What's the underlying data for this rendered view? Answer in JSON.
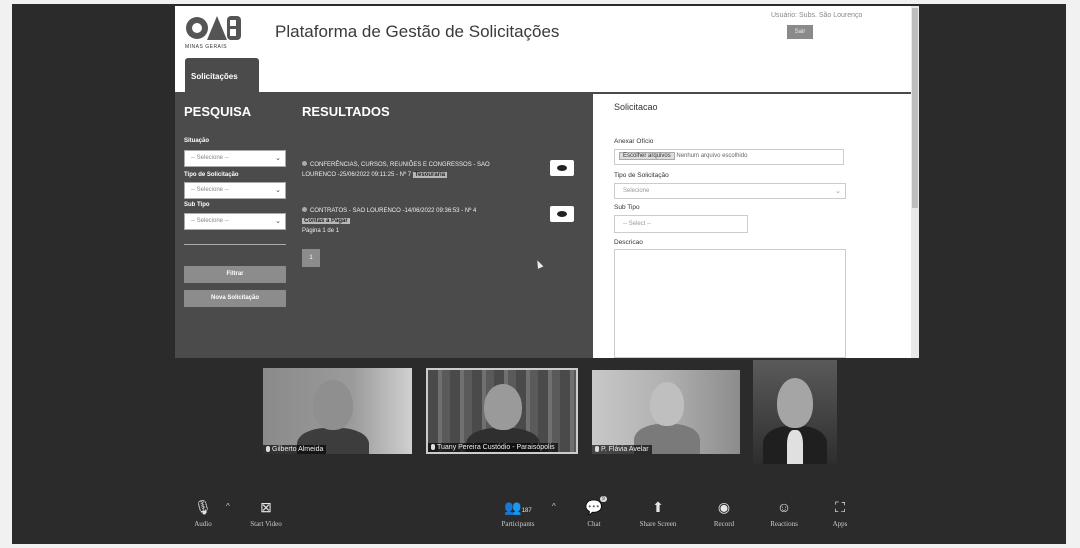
{
  "app": {
    "title": "Plataforma de Gestão de Solicitações",
    "logo_text": "OAB",
    "logo_sub": "MINAS GERAIS",
    "user_name": "Usuário: Subs. São Lourenço",
    "logout_label": "Sair",
    "tab_label": "Solicitações"
  },
  "search": {
    "title": "PESQUISA",
    "situacao_label": "Situação",
    "situacao_value": "-- Selecione --",
    "tipo_label": "Tipo de Solicitação",
    "tipo_value": "-- Selecione --",
    "subtipo_label": "Sub Tipo",
    "subtipo_value": "-- Selecione --",
    "filter_button": "Filtrar",
    "new_button": "Nova Solicitação"
  },
  "results": {
    "title": "RESULTADOS",
    "items": [
      {
        "text": "CONFERÊNCIAS, CURSOS, REUNIÕES E CONGRESSOS - SAO LOURENCO -25/06/2022 09:11:25 - Nº 7",
        "tag": "Tesouraria"
      },
      {
        "text": "CONTRATOS - SAO LOURENCO -14/06/2022 09:36:53 - Nº 4",
        "tag": "Contas a Pagar"
      }
    ],
    "page_info": "Página 1 de 1",
    "page_number": "1"
  },
  "form": {
    "title": "Solicitacao",
    "oficio_label": "Anexar Ofício",
    "file_button": "Escolher arquivos",
    "file_status": "Nenhum arquivo escolhido",
    "tipo_label": "Tipo de Solicitação",
    "tipo_value": "Selecione",
    "subtipo_label": "Sub Tipo",
    "subtipo_value": "-- Select --",
    "descricao_label": "Descricao"
  },
  "participants": [
    {
      "name": "Gilberto Almeida"
    },
    {
      "name": "Tuany Pereira Custódio - Paraisópolis"
    },
    {
      "name": "P. Flávia Avelar"
    },
    {
      "name": ""
    }
  ],
  "toolbar": {
    "audio": "Audio",
    "video": "Start Video",
    "participants": "Participants",
    "participant_count": "187",
    "chat": "Chat",
    "chat_badge": "9",
    "share": "Share Screen",
    "record": "Record",
    "reactions": "Reactions",
    "apps": "Apps"
  }
}
